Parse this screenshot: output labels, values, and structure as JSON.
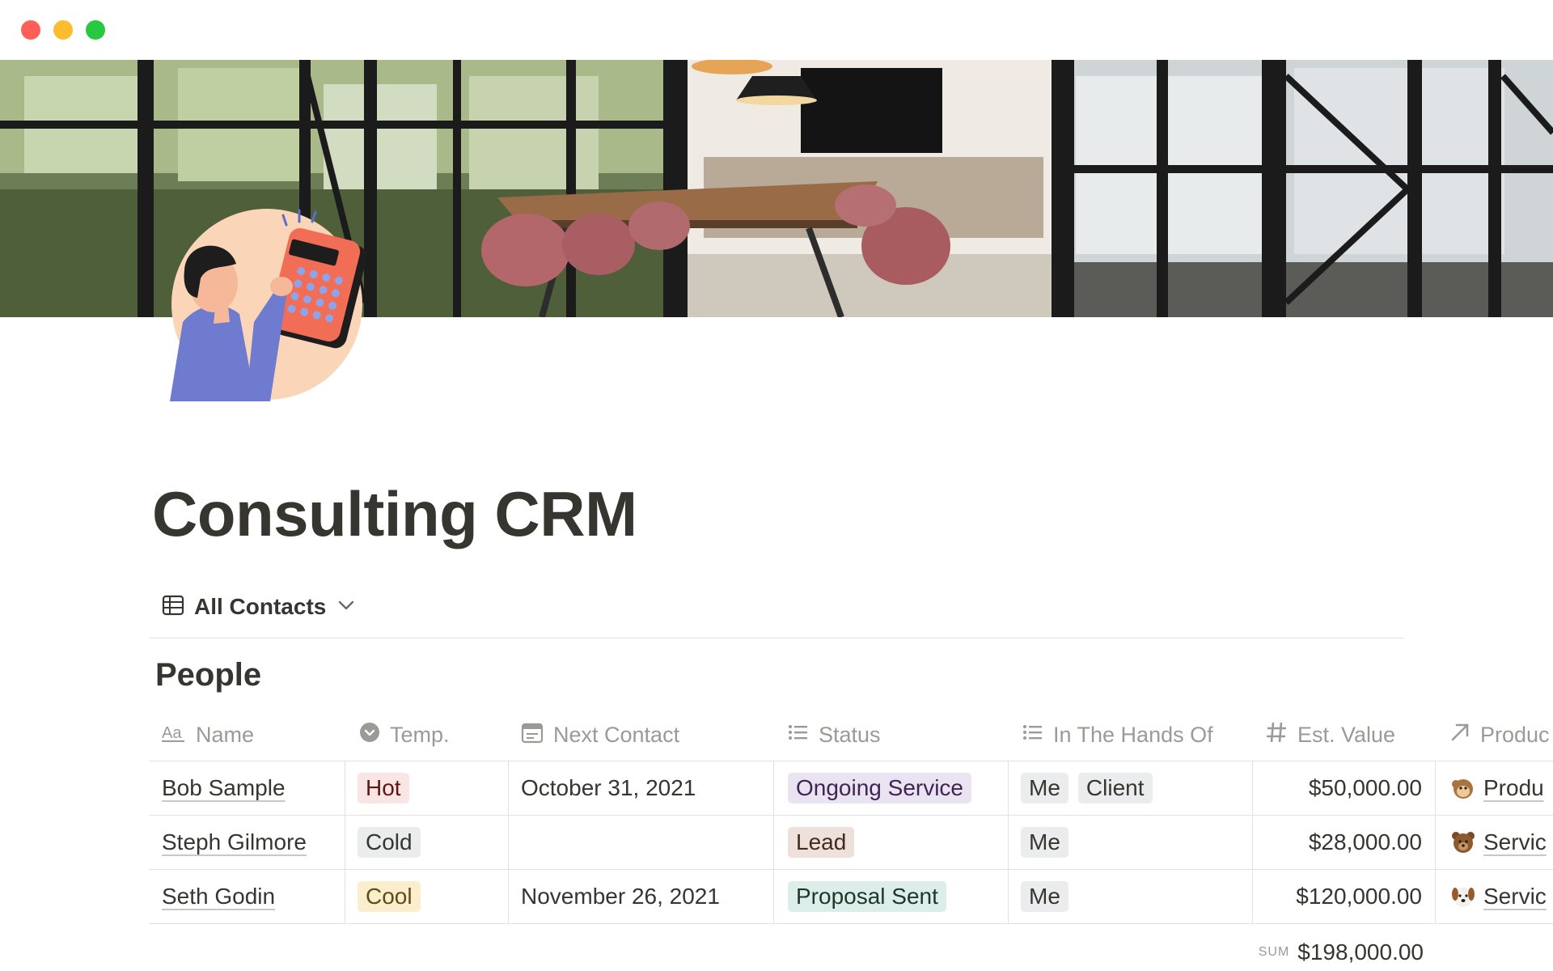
{
  "page": {
    "title": "Consulting CRM"
  },
  "view": {
    "label": "All Contacts"
  },
  "database": {
    "title": "People",
    "columns": [
      {
        "label": "Name",
        "icon": "text-property-icon"
      },
      {
        "label": "Temp.",
        "icon": "select-property-icon"
      },
      {
        "label": "Next Contact",
        "icon": "calendar-property-icon"
      },
      {
        "label": "Status",
        "icon": "list-property-icon"
      },
      {
        "label": "In The Hands Of",
        "icon": "list-property-icon"
      },
      {
        "label": "Est. Value",
        "icon": "number-property-icon"
      },
      {
        "label": "Produc",
        "icon": "relation-arrow-icon"
      }
    ],
    "rows": [
      {
        "name": "Bob Sample",
        "temp": {
          "label": "Hot",
          "color": "#fbe4e4"
        },
        "next_contact": "October 31, 2021",
        "status": {
          "label": "Ongoing Service",
          "color": "#eae4f2"
        },
        "hands": [
          "Me",
          "Client"
        ],
        "value": "$50,000.00",
        "product": {
          "label": "Produ",
          "icon": "monkey-emoji-icon"
        }
      },
      {
        "name": "Steph Gilmore",
        "temp": {
          "label": "Cold",
          "color": "#ebeced"
        },
        "next_contact": "",
        "status": {
          "label": "Lead",
          "color": "#eee0da"
        },
        "hands": [
          "Me"
        ],
        "value": "$28,000.00",
        "product": {
          "label": "Servic",
          "icon": "bear-emoji-icon"
        }
      },
      {
        "name": "Seth Godin",
        "temp": {
          "label": "Cool",
          "color": "#fbeecc"
        },
        "next_contact": "November 26, 2021",
        "status": {
          "label": "Proposal Sent",
          "color": "#ddedea"
        },
        "hands": [
          "Me"
        ],
        "value": "$120,000.00",
        "product": {
          "label": "Servic",
          "icon": "dog-emoji-icon"
        }
      }
    ],
    "sum": {
      "label": "SUM",
      "value": "$198,000.00"
    }
  },
  "colors": {
    "text": "#37352f",
    "muted": "#9b9a97",
    "divider": "#e3e2e0"
  }
}
